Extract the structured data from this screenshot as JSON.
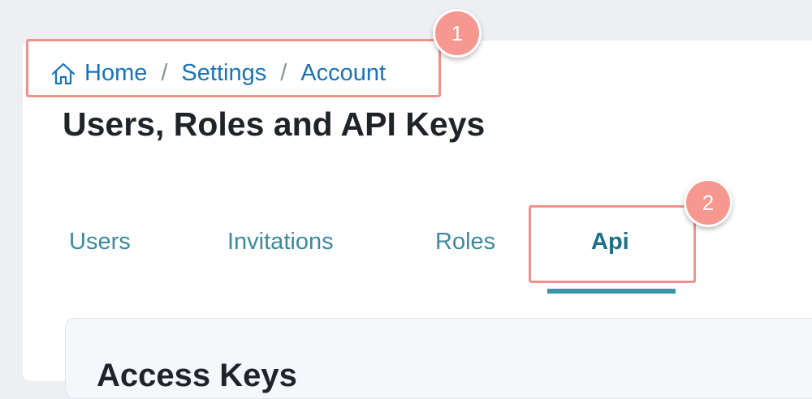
{
  "breadcrumb": {
    "icon": "home-icon",
    "items": [
      "Home",
      "Settings",
      "Account"
    ],
    "separator": "/"
  },
  "page": {
    "title": "Users, Roles and API Keys"
  },
  "tabs": [
    {
      "label": "Users",
      "active": false
    },
    {
      "label": "Invitations",
      "active": false
    },
    {
      "label": "Roles",
      "active": false
    },
    {
      "label": "Api",
      "active": true
    }
  ],
  "panel": {
    "title": "Access Keys"
  },
  "annotations": {
    "markers": [
      "1",
      "2"
    ]
  },
  "colors": {
    "link": "#1a73b5",
    "tab": "#3c8a9e",
    "tab_underline": "#3d93a8",
    "annotation": "#f4908a"
  }
}
